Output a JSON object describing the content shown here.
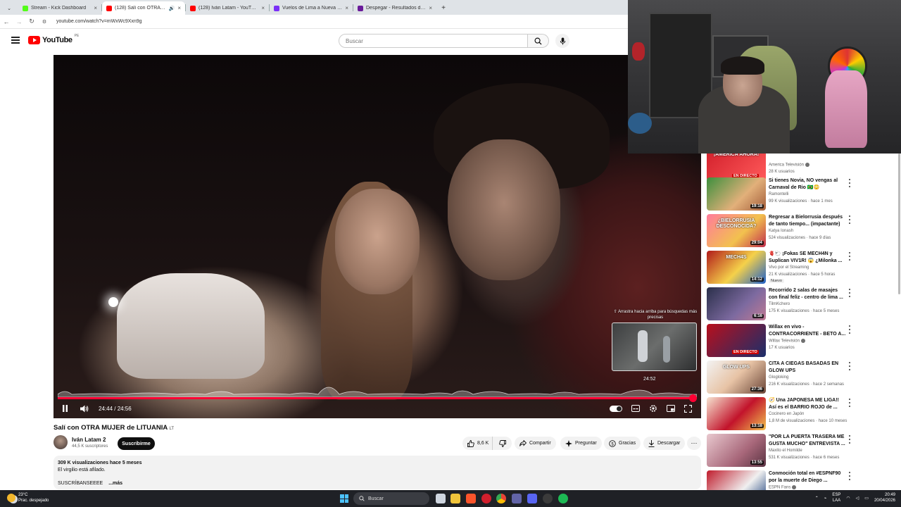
{
  "browser": {
    "tabs": [
      {
        "label": "Stream - Kick Dashboard",
        "favicon_color": "#53fc18"
      },
      {
        "label": "(128) Salí con OTRA MUJER",
        "favicon_color": "#ff0000",
        "active": true
      },
      {
        "label": "(128) Iván Latam - YouTube",
        "favicon_color": "#ff0000"
      },
      {
        "label": "Vuelos de Lima a Nueva Delhi |",
        "favicon_color": "#7b2ff7"
      },
      {
        "label": "Despegar - Resultados de Vuelo",
        "favicon_color": "#6a1b9a"
      }
    ],
    "new_tab": "+",
    "close_glyph": "×",
    "url": "youtube.com/watch?v=mWxWc9Xxn9g"
  },
  "header": {
    "logo_word": "YouTube",
    "logo_country": "PE",
    "search_placeholder": "Buscar"
  },
  "player": {
    "drag_hint": "⇧ Arrastra hacia arriba para búsquedas más precisas",
    "preview_time": "24:52",
    "time_display": "24:44 / 24:56",
    "progress_fraction": 0.993,
    "accent_color": "#ff0033"
  },
  "video": {
    "title": "Salí con OTRA MUJER de LITUANIA",
    "title_flag": "LT",
    "channel": "Iván Latam 2",
    "subscribers": "44,5 K suscriptores",
    "subscribe_label": "Suscribirme",
    "likes": "8,6 K",
    "share_label": "Compartir",
    "ask_label": "Preguntar",
    "thanks_label": "Gracias",
    "download_label": "Descargar"
  },
  "description": {
    "meta": "309 K visualizaciones  hace 5 meses",
    "line1": "El virgilio está afilado.",
    "line2": "SUSCRÍBANSEEEE",
    "more": "...más"
  },
  "recommendations": [
    {
      "title": "",
      "channel": "America Televisión",
      "stats": "28 K usuarios",
      "duration": "",
      "verified": true,
      "thumb": "linear-gradient(135deg,#d21f2b,#ff5a5a)",
      "thumb_text": "¡AMÉRICA AHORA!",
      "live_tag": "EN DIRECTO"
    },
    {
      "title": "Si tienes Novia, NO vengas al Carnaval de Rio 🇧🇷😳",
      "channel": "Ramontelli",
      "stats": "99 K visualizaciones · hace 1 mes",
      "duration": "19:18",
      "thumb": "linear-gradient(135deg,#3c8f3d,#e2b07a 60%,#a35d3a)"
    },
    {
      "title": "Regresar a Bielorrusia después de tanto tiempo... (impactante)",
      "channel": "Katya Ionash",
      "stats": "524 visualizaciones · hace 9 días",
      "duration": "29:04",
      "thumb": "linear-gradient(135deg,#ff7b9c,#f2c14e 60%,#c02d4d)",
      "thumb_text": "¿BIELORRUSIA DESCONOCIDA?"
    },
    {
      "title": "🫀🐑 ¡Fokas SE MECH4N y Suplican VIV1R! 😱 ¿Milonka ...",
      "channel": "Vivo por el Streaming",
      "stats": "21 K visualizaciones · hace 5 horas",
      "duration": "14:12",
      "badge": "Nuevo",
      "thumb": "linear-gradient(135deg,#b11a1a,#f5d14a 55%,#1e60c9)",
      "thumb_text": "MECH4S"
    },
    {
      "title": "Recorrido 2 salas de masajes con final feliz - centro de lima ...",
      "channel": "TilmKchero",
      "stats": "175 K visualizaciones · hace 5 meses",
      "duration": "6:16",
      "thumb": "linear-gradient(135deg,#2a2f4a,#7d6aa0 60%,#c07a94)"
    },
    {
      "title": "Willax en vivo - CONTRACORRIENTE - BETO A...",
      "channel": "Willax Televisión",
      "stats": "17 K usuarios",
      "duration": "",
      "verified": true,
      "thumb": "linear-gradient(135deg,#b80f1c,#1b2f6b)",
      "live_tag": "EN DIRECTO"
    },
    {
      "title": "CITA A CIEGAS BASADAS EN GLOW UPS",
      "channel": "Glogloking",
      "stats": "216 K visualizaciones · hace 2 semanas",
      "duration": "27:36",
      "thumb": "linear-gradient(135deg,#f3f3f3,#e7c3a5 50%,#6a4436)",
      "thumb_text": "GLOW UPS"
    },
    {
      "title": "🧭 Una JAPONESA ME LIGA!! Así es el BARRIO ROJO de ...",
      "channel": "Cocinero en Japón",
      "stats": "1,8 M de visualizaciones · hace 10 meses",
      "duration": "13:18",
      "thumb": "linear-gradient(135deg,#f6e3d0,#c2132b 55%,#f2c14e)"
    },
    {
      "title": "\"POR LA PUERTA TRASERA ME GUSTA MUCHO\" ENTREVISTA ...",
      "channel": "Maxito el Homilde",
      "stats": "531 K visualizaciones · hace 6 meses",
      "duration": "13:55",
      "thumb": "linear-gradient(135deg,#e9c9cf,#a8677a 60%,#5a3342)"
    },
    {
      "title": "Conmoción total en #ESPNF90 por la muerte de Diego ...",
      "channel": "ESPN Fans",
      "stats": "",
      "duration": "",
      "verified": true,
      "thumb": "linear-gradient(135deg,#c01c2c,#f0f0f0 60%,#193d7a)"
    }
  ],
  "taskbar": {
    "temperature": "23°C",
    "weather": "Prac. despejado",
    "search_placeholder": "Buscar",
    "lang_line1": "ESP",
    "lang_line2": "LAA",
    "time": "20:49",
    "date": "20/04/2026"
  },
  "icon_names": [
    "menu-icon",
    "search-icon",
    "mic-icon",
    "pause-icon",
    "volume-icon",
    "autoplay-toggle",
    "subtitles-icon",
    "settings-icon",
    "miniplayer-icon",
    "fullscreen-icon",
    "like-icon",
    "dislike-icon",
    "share-icon",
    "ask-icon",
    "thanks-icon",
    "download-icon",
    "more-icon"
  ]
}
